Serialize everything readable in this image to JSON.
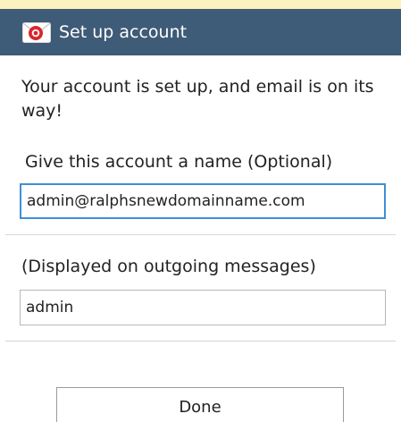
{
  "header": {
    "title": "Set up account",
    "icon": "email-app-icon",
    "background_color": "#3e5b77"
  },
  "message": "Your account is set up, and email is on its way!",
  "account_name": {
    "label": "Give this account a name (Optional)",
    "value": "admin@ralphsnewdomainname.com"
  },
  "display_name": {
    "label": "(Displayed on outgoing messages)",
    "value": "admin"
  },
  "actions": {
    "done_label": "Done"
  },
  "colors": {
    "accent": "#3f8fd6",
    "top_strip": "#fbf3bf"
  }
}
